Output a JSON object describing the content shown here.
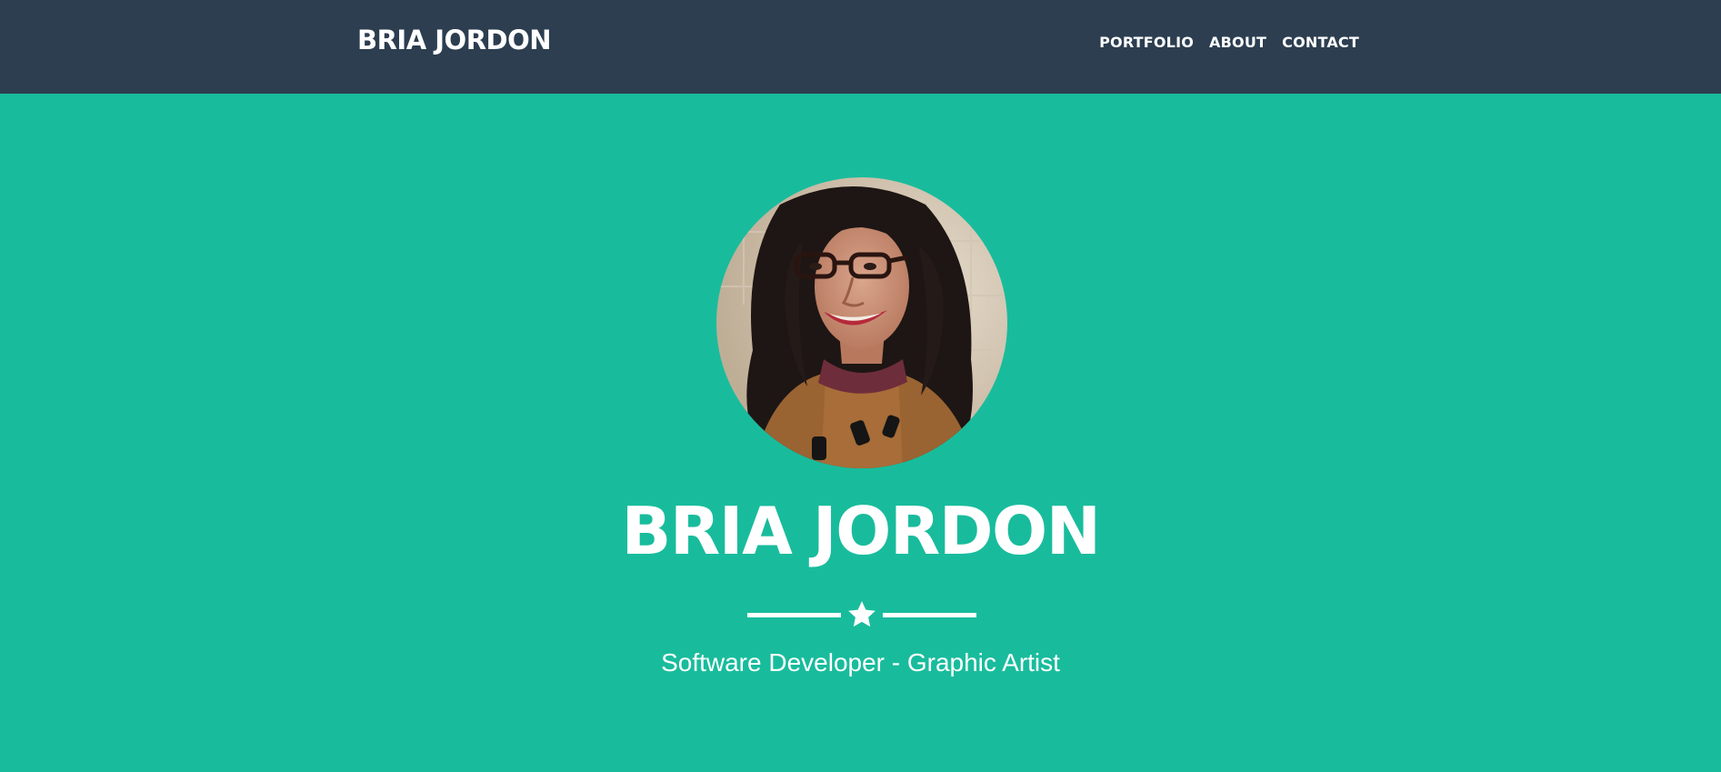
{
  "navbar": {
    "brand": "BRIA JORDON",
    "links": [
      {
        "label": "PORTFOLIO"
      },
      {
        "label": "ABOUT"
      },
      {
        "label": "CONTACT"
      }
    ]
  },
  "hero": {
    "title": "BRIA JORDON",
    "subtitle": "Software Developer - Graphic Artist",
    "divider_icon": "star-icon",
    "avatar_alt": "profile photo"
  },
  "colors": {
    "navbar_bg": "#2c3e50",
    "hero_bg": "#18bc9c",
    "text": "#ffffff"
  }
}
